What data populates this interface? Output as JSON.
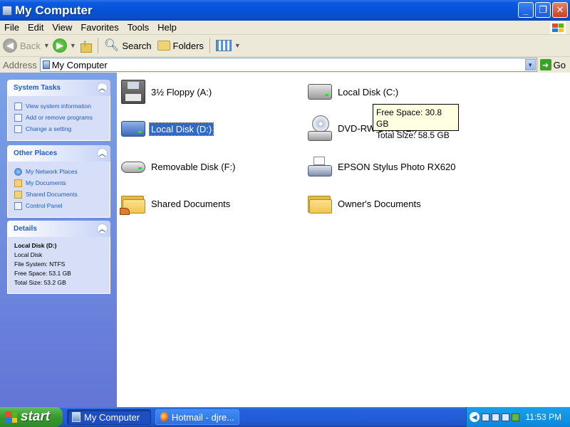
{
  "window": {
    "title": "My Computer",
    "controls": {
      "minimize": "_",
      "maximize": "❐",
      "close": "✕"
    }
  },
  "menubar": {
    "items": [
      "File",
      "Edit",
      "View",
      "Favorites",
      "Tools",
      "Help"
    ]
  },
  "toolbar": {
    "back_label": "Back",
    "search_label": "Search",
    "folders_label": "Folders"
  },
  "address": {
    "label": "Address",
    "value": "My Computer",
    "go_label": "Go"
  },
  "task_pane": {
    "system_tasks": {
      "title": "System Tasks",
      "links": [
        "View system information",
        "Add or remove programs",
        "Change a setting"
      ]
    },
    "other_places": {
      "title": "Other Places",
      "links": [
        "My Network Places",
        "My Documents",
        "Shared Documents",
        "Control Panel"
      ]
    },
    "details": {
      "title": "Details",
      "name": "Local Disk (D:)",
      "type": "Local Disk",
      "file_system": "File System: NTFS",
      "free_space": "Free Space: 53.1 GB",
      "total_size": "Total Size: 53.2 GB"
    }
  },
  "content": {
    "items": [
      {
        "label": "3½ Floppy (A:)",
        "icon": "floppy-icon"
      },
      {
        "label": "Local Disk (C:)",
        "icon": "hard-drive-icon"
      },
      {
        "label": "Local Disk (D:)",
        "icon": "hard-drive-icon",
        "selected": true
      },
      {
        "label": "DVD-RW Drive (E:)",
        "icon": "dvd-drive-icon"
      },
      {
        "label": "Removable Disk (F:)",
        "icon": "removable-disk-icon"
      },
      {
        "label": "EPSON Stylus Photo RX620",
        "icon": "scanner-icon"
      },
      {
        "label": "Shared Documents",
        "icon": "shared-folder-icon"
      },
      {
        "label": "Owner's Documents",
        "icon": "folder-icon"
      }
    ],
    "tooltip": {
      "free_space": "Free Space: 30.8 GB",
      "total_size": "Total Size: 58.5 GB"
    }
  },
  "taskbar": {
    "start_label": "start",
    "buttons": [
      "My Computer",
      "Hotmail - djre..."
    ],
    "clock": "11:53 PM"
  }
}
